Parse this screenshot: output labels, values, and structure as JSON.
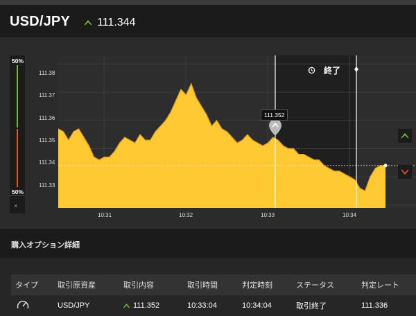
{
  "header": {
    "pair": "USD/JPY",
    "price": "111.344"
  },
  "gauge": {
    "top_label": "50%",
    "bottom_label": "50%",
    "close_symbol": "×"
  },
  "chart_data": {
    "type": "area",
    "y_ticks": [
      "111.38",
      "111.37",
      "111.36",
      "111.35",
      "111.34",
      "111.33"
    ],
    "x_ticks": [
      "10:31",
      "10:32",
      "10:33",
      "10:34"
    ],
    "tooltip": "111.352",
    "end_label": "終了",
    "series": [
      {
        "values": [
          111.357,
          111.356,
          111.353,
          111.356,
          111.357,
          111.354,
          111.351,
          111.347,
          111.346,
          111.347,
          111.347,
          111.349,
          111.352,
          111.354,
          111.353,
          111.352,
          111.355,
          111.353,
          111.353,
          111.356,
          111.358,
          111.36,
          111.363,
          111.367,
          111.371,
          111.369,
          111.373,
          111.368,
          111.365,
          111.362,
          111.358,
          111.36,
          111.357,
          111.356,
          111.354,
          111.352,
          111.353,
          111.355,
          111.353,
          111.352,
          111.351,
          111.352,
          111.354,
          111.353,
          111.351,
          111.35,
          111.35,
          111.348,
          111.348,
          111.347,
          111.346,
          111.346,
          111.344,
          111.343,
          111.342,
          111.342,
          111.341,
          111.34,
          111.339,
          111.336,
          111.335,
          111.34,
          111.343,
          111.344,
          111.344
        ]
      }
    ],
    "colors": {
      "fill": "#ffc933",
      "line": "#e89a12",
      "grid": "#3d3d3d"
    }
  },
  "buttons": {
    "up_color": "#6ebe3b",
    "down_color": "#e8552b"
  },
  "section": {
    "title": "購入オプション詳細"
  },
  "table": {
    "headers": [
      "タイプ",
      "取引原資産",
      "取引内容",
      "取引時間",
      "判定時刻",
      "ステータス",
      "判定レート"
    ],
    "row": {
      "asset": "USD/JPY",
      "content": "111.352",
      "trade_time": "10:33:04",
      "judge_time": "10:34:04",
      "status": "取引終了",
      "rate": "111.336"
    }
  }
}
